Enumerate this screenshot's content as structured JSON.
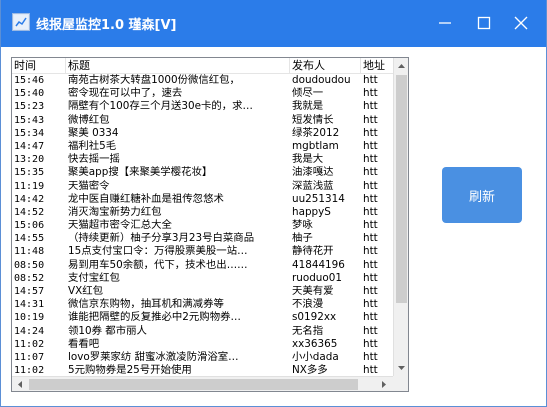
{
  "window": {
    "title": "线报屋监控1.0 瑾森[V]"
  },
  "columns": [
    "时间",
    "标题",
    "发布人",
    "地址"
  ],
  "rows": [
    {
      "time": "15:46",
      "title": "南苑古树茶大转盘1000份微信红包，",
      "publisher": "doudoudou",
      "addr": "htt"
    },
    {
      "time": "15:40",
      "title": "密令现在可以中了，速去",
      "publisher": "倾尽一",
      "addr": "htt"
    },
    {
      "time": "15:23",
      "title": "隔壁有个100存三个月送30e卡的，求…",
      "publisher": "我就是",
      "addr": "htt"
    },
    {
      "time": "15:43",
      "title": "微博红包",
      "publisher": "短发情长",
      "addr": "htt"
    },
    {
      "time": "15:34",
      "title": "聚美 0334",
      "publisher": "绿茶2012",
      "addr": "htt"
    },
    {
      "time": "14:47",
      "title": "福利社5毛",
      "publisher": "mgbtlam",
      "addr": "htt"
    },
    {
      "time": "13:20",
      "title": "快去摇一摇",
      "publisher": "我是大",
      "addr": "htt"
    },
    {
      "time": "15:35",
      "title": "聚美app搜【来聚美学樱花妆】",
      "publisher": "油漆嘎达",
      "addr": "htt"
    },
    {
      "time": "11:19",
      "title": "天猫密令",
      "publisher": "深蓝浅蓝",
      "addr": "htt"
    },
    {
      "time": "14:42",
      "title": "龙中医自赚红糖补血是祖传忽悠术",
      "publisher": "uu251314",
      "addr": "htt"
    },
    {
      "time": "14:52",
      "title": "消灭淘宝新势力红包",
      "publisher": "happyS",
      "addr": "htt"
    },
    {
      "time": "15:06",
      "title": "天猫超市密令汇总大全",
      "publisher": "梦咏",
      "addr": "htt"
    },
    {
      "time": "14:55",
      "title": "（持续更新）柚子分享3月23号白菜商品",
      "publisher": "柚子",
      "addr": "htt"
    },
    {
      "time": "11:48",
      "title": "15点支付宝口令：万得股票美股一站…",
      "publisher": "静待花开",
      "addr": "htt"
    },
    {
      "time": "08:50",
      "title": "易到用车50余额，代下，技术也出……",
      "publisher": "41844196",
      "addr": "htt"
    },
    {
      "time": "08:52",
      "title": "支付宝红包",
      "publisher": "ruoduo01",
      "addr": "htt"
    },
    {
      "time": "14:57",
      "title": "VX红包",
      "publisher": "天美有爱",
      "addr": "htt"
    },
    {
      "time": "14:31",
      "title": "微信京东购物，抽耳机和满减券等",
      "publisher": "不浪漫",
      "addr": "htt"
    },
    {
      "time": "10:19",
      "title": "谁能把隔壁的反复推必中2元购物券…",
      "publisher": "s0192xx",
      "addr": "htt"
    },
    {
      "time": "14:24",
      "title": "领10券 都市丽人",
      "publisher": "无名指",
      "addr": "htt"
    },
    {
      "time": "11:02",
      "title": "看看吧",
      "publisher": "xx36365",
      "addr": "htt"
    },
    {
      "time": "11:07",
      "title": "lovo罗莱家纺 甜蜜冰激凌防滑浴室…",
      "publisher": "小小dada",
      "addr": "htt"
    },
    {
      "time": "11:02",
      "title": "5元购物券是25号开始使用",
      "publisher": "NX多多",
      "addr": "htt"
    }
  ],
  "refresh_label": "刷新",
  "colors": {
    "titlebar": "#2b7ce9",
    "button": "#4a90e2"
  }
}
